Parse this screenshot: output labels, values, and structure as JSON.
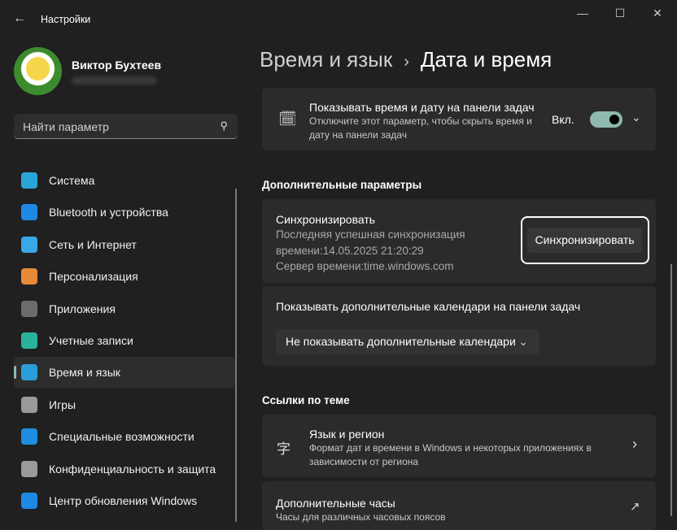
{
  "window": {
    "title": "Настройки",
    "back_icon": "←",
    "minimize": "—",
    "maximize": "☐",
    "close": "✕"
  },
  "user": {
    "name": "Виктор Бухтеев"
  },
  "search": {
    "placeholder": "Найти параметр",
    "icon": "⚲"
  },
  "sidebar": {
    "items": [
      {
        "label": "Система",
        "color": "#2aa5d9"
      },
      {
        "label": "Bluetooth и устройства",
        "color": "#1e88e5"
      },
      {
        "label": "Сеть и Интернет",
        "color": "#3aa7e6"
      },
      {
        "label": "Персонализация",
        "color": "#e68a3a"
      },
      {
        "label": "Приложения",
        "color": "#6c6c6c"
      },
      {
        "label": "Учетные записи",
        "color": "#2bb39a"
      },
      {
        "label": "Время и язык",
        "color": "#2a9ed8",
        "selected": true
      },
      {
        "label": "Игры",
        "color": "#9a9a9a"
      },
      {
        "label": "Специальные возможности",
        "color": "#1e8fe0"
      },
      {
        "label": "Конфиденциальность и защита",
        "color": "#9b9b9b"
      },
      {
        "label": "Центр обновления Windows",
        "color": "#1e88e5"
      }
    ]
  },
  "breadcrumb": {
    "parent": "Время и язык",
    "sep": "›",
    "current": "Дата и время"
  },
  "taskbar_card": {
    "title": "Показывать время и дату на панели задач",
    "desc": "Отключите этот параметр, чтобы скрыть время и дату на панели задач",
    "state": "Вкл.",
    "toggle_on": true
  },
  "section_additional": "Дополнительные параметры",
  "sync": {
    "title": "Синхронизировать",
    "line1": "Последняя успешная синхронизация",
    "line2": "времени:14.05.2025 21:20:29",
    "line3": "Сервер времени:time.windows.com",
    "button": "Синхронизировать"
  },
  "calendars": {
    "title": "Показывать дополнительные календари на панели задач",
    "selected": "Не показывать дополнительные календари"
  },
  "section_links": "Ссылки по теме",
  "links": [
    {
      "title": "Язык и регион",
      "desc1": "Формат дат и времени в Windows и некоторых приложениях в",
      "desc2": "зависимости от региона",
      "arrow": "›"
    },
    {
      "title": "Дополнительные часы",
      "desc1": "Часы для различных часовых поясов",
      "arrow": "↗"
    }
  ]
}
